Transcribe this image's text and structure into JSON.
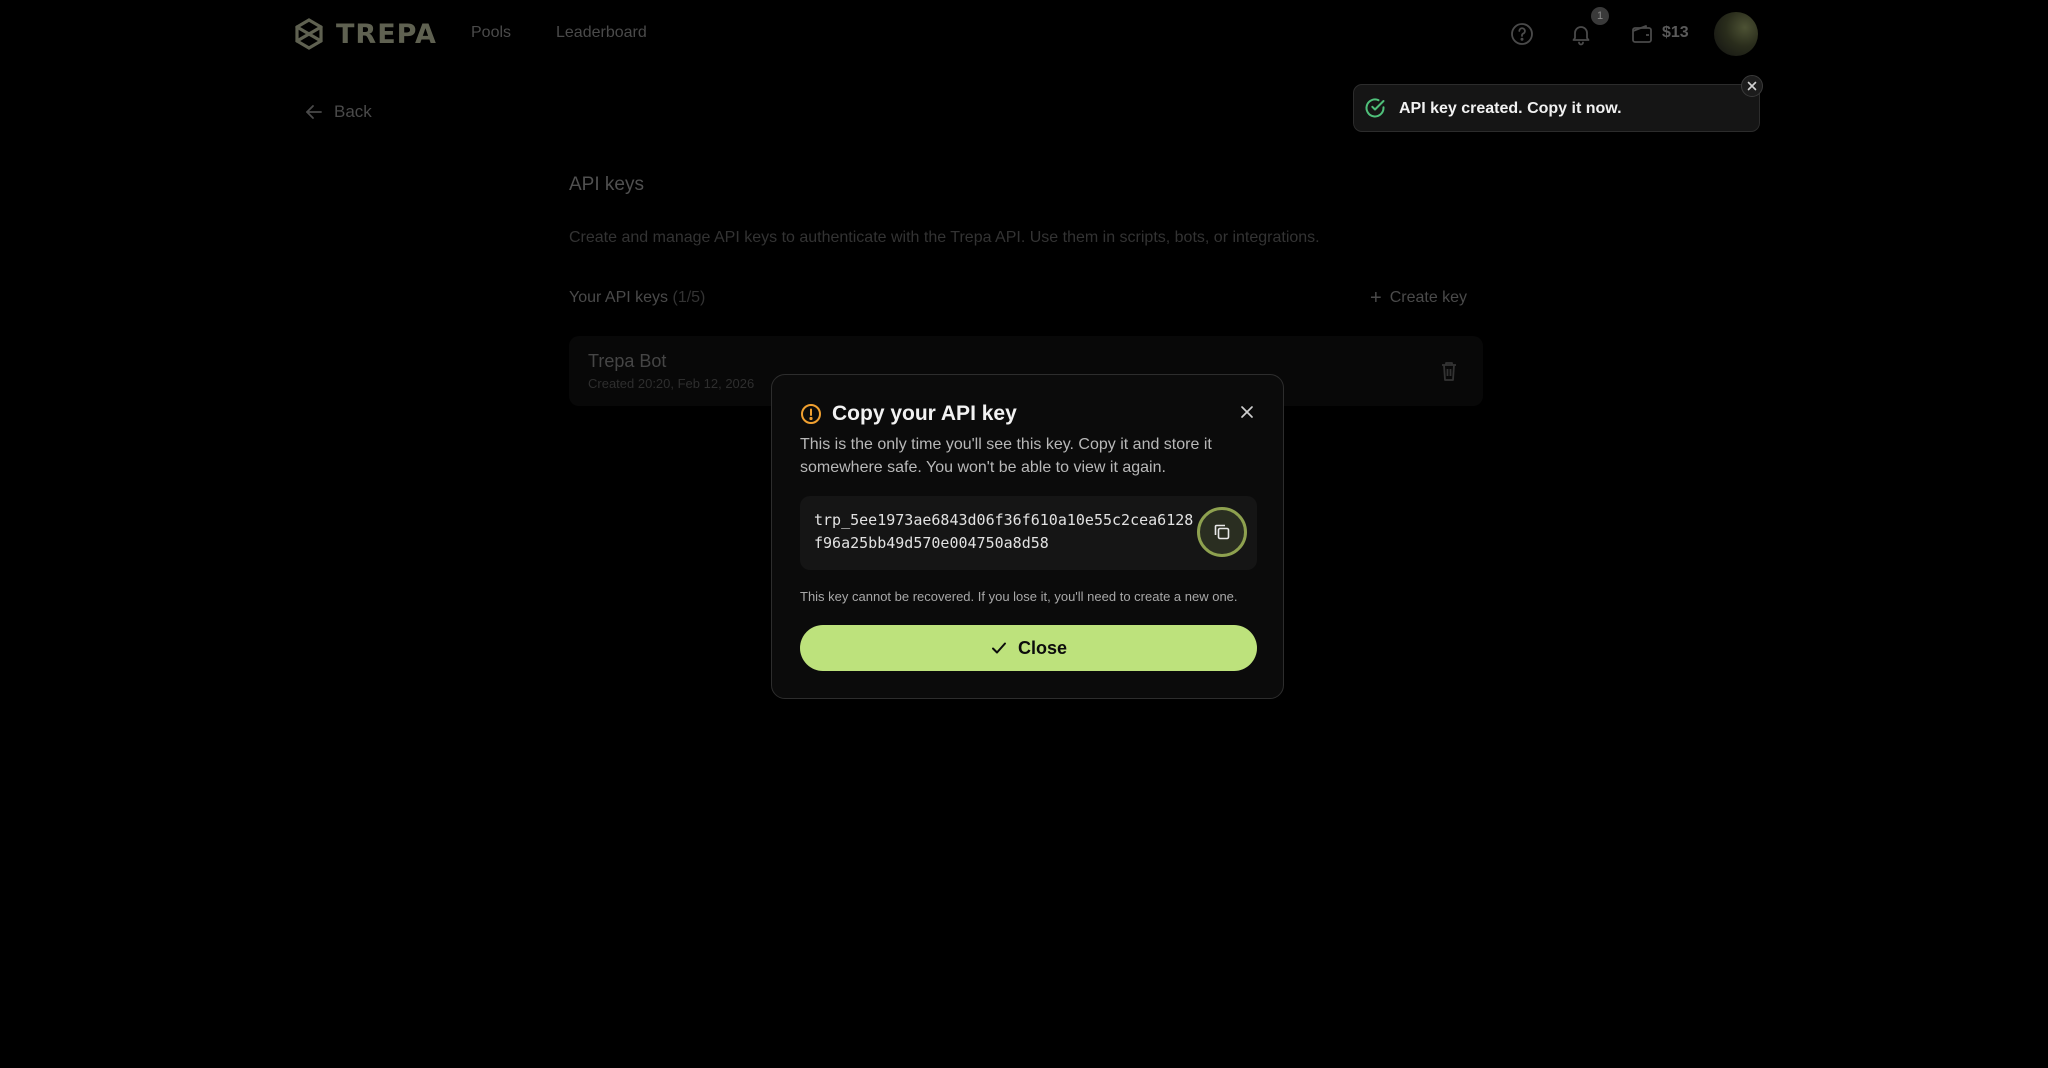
{
  "header": {
    "logo_text": "TREPA",
    "nav": [
      {
        "label": "Pools"
      },
      {
        "label": "Leaderboard"
      }
    ],
    "notification_count": "1",
    "balance": "$13"
  },
  "back_label": "Back",
  "content": {
    "title": "API keys",
    "description": "Create and manage API keys to authenticate with the Trepa API. Use them in scripts, bots, or integrations.",
    "keys_heading": "Your API keys",
    "keys_count": "(1/5)",
    "create_label": "Create key",
    "keys": [
      {
        "name": "Trepa Bot",
        "created": "Created 20:20, Feb 12, 2026"
      }
    ]
  },
  "toast": {
    "message": "API key created. Copy it now."
  },
  "modal": {
    "title": "Copy your API key",
    "description": "This is the only time you'll see this key. Copy it and store it somewhere safe. You won't be able to view it again.",
    "api_key": "trp_5ee1973ae6843d06f36f610a10e55c2cea6128f96a25bb49d570e004750a8d58",
    "note": "This key cannot be recovered. If you lose it, you'll need to create a new one.",
    "close_label": "Close"
  },
  "colors": {
    "accent": "#bde27c",
    "warning": "#f0a030",
    "success": "#4fc07a"
  }
}
